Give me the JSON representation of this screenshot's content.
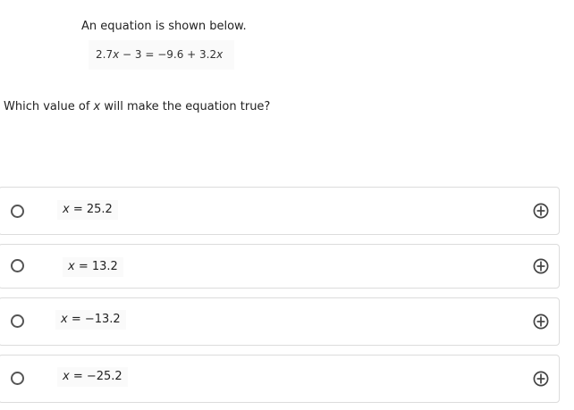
{
  "intro": {
    "text": "An equation is shown below."
  },
  "equation": {
    "lhs_num": "2.7",
    "lhs_var": "x",
    "lhs_rest": " − 3 = −9.6 + 3.2",
    "rhs_var": "x"
  },
  "question": {
    "prefix": "Which value of ",
    "var": "x",
    "suffix": " will make the equation true?"
  },
  "choices": [
    {
      "var": "x",
      "rest": " = 25.2"
    },
    {
      "var": "x",
      "rest": " = 13.2"
    },
    {
      "var": "x",
      "rest": " = −13.2"
    },
    {
      "var": "x",
      "rest": " = −25.2"
    }
  ],
  "icons": {
    "radio": "radio-button-icon",
    "eliminate": "eliminate-choice-icon"
  },
  "colors": {
    "border": "#dcdcdc",
    "icon": "#444444"
  }
}
